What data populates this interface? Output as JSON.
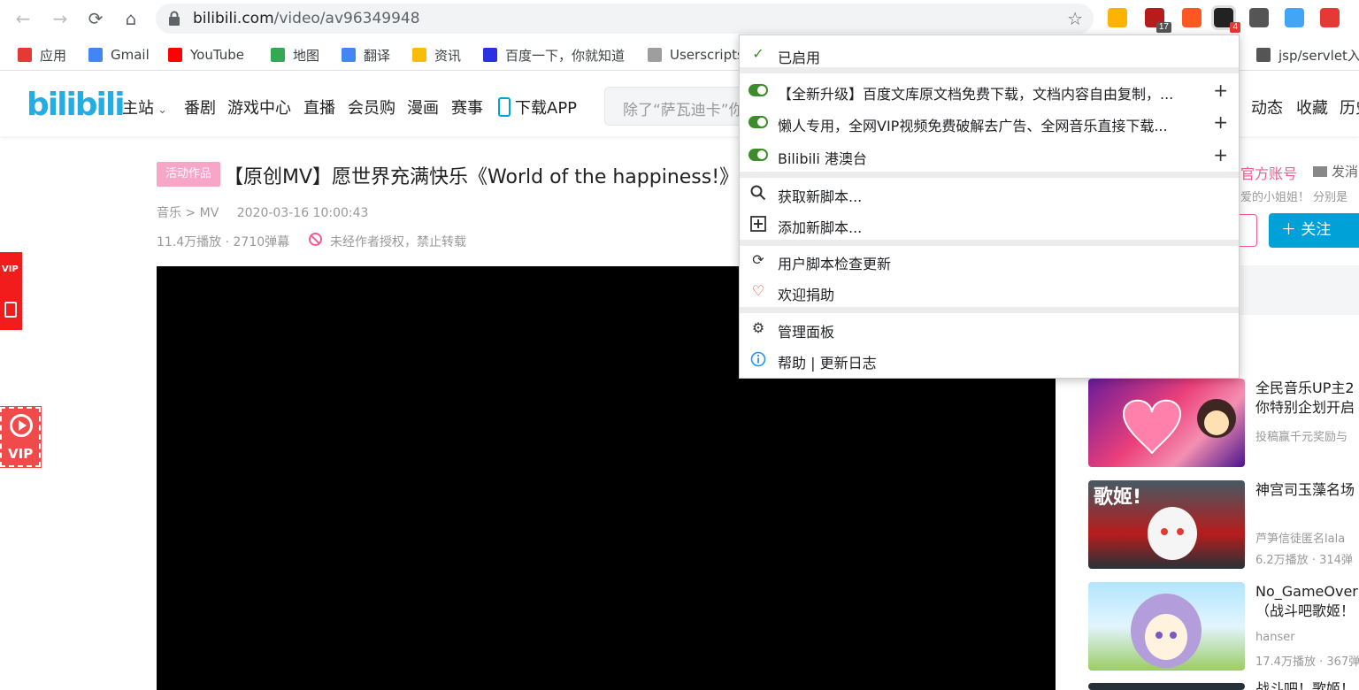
{
  "browser": {
    "url_host": "bilibili.com",
    "url_path": "/video/av96349948",
    "extensions": [
      {
        "name": "zap-icon",
        "color": "#ffb300",
        "badge": ""
      },
      {
        "name": "shield-icon",
        "color": "#b71c1c",
        "badge": "17"
      },
      {
        "name": "infinity-icon",
        "color": "#ff5722",
        "badge": ""
      },
      {
        "name": "tampermonkey-icon",
        "color": "#222222",
        "badge": "4"
      },
      {
        "name": "pocket-icon",
        "color": "#555555",
        "badge": ""
      },
      {
        "name": "search-circle-icon",
        "color": "#42a5f5",
        "badge": ""
      },
      {
        "name": "calendar-icon",
        "color": "#e53935",
        "badge": ""
      }
    ]
  },
  "bookmarks": [
    {
      "label": "应用",
      "color": "#e53935"
    },
    {
      "label": "Gmail",
      "color": "#4285f4"
    },
    {
      "label": "YouTube",
      "color": "#ff0000"
    },
    {
      "label": "地图",
      "color": "#34a853"
    },
    {
      "label": "翻译",
      "color": "#4285f4"
    },
    {
      "label": "资讯",
      "color": "#fbbc05"
    },
    {
      "label": "百度一下，你就知道",
      "color": "#2932e1"
    },
    {
      "label": "Userscripts",
      "color": "#9e9e9e"
    },
    {
      "label": "jsp/servlet入",
      "color": "#555555"
    }
  ],
  "bili": {
    "logo": "bilibili",
    "nav": [
      "主站",
      "番剧",
      "游戏中心",
      "直播",
      "会员购",
      "漫画",
      "赛事",
      "下载APP"
    ],
    "search_placeholder": "除了“萨瓦迪卡”你",
    "right_nav": [
      "动态",
      "收藏",
      "历史"
    ]
  },
  "video": {
    "tag": "活动作品",
    "title": "【原创MV】愿世界充满快乐《World of the happiness!》【",
    "category": "音乐 > MV",
    "date": "2020-03-16 10:00:43",
    "stats": "11.4万播放 · 2710弹幕",
    "no_repost": "未经作者授权，禁止转载"
  },
  "sidebar_vip": {
    "badge1": "VIP",
    "badge2": "VIP"
  },
  "uploader": {
    "official": "官方账号",
    "message": "发消",
    "desc": "爱的小姐姐！ 分别是",
    "follow": "＋  关注"
  },
  "recommendations": [
    {
      "title1": "全民音乐UP主2",
      "title2": "你特别企划开启",
      "up": "投稿赢千元奖励与",
      "stat": ""
    },
    {
      "title1": "神宫司玉藻名场",
      "title2": "",
      "up": "芦笋信徒匿名lala",
      "stat": "6.2万播放 · 314弹"
    },
    {
      "title1": "No_GameOver",
      "title2": "（战斗吧歌姬！",
      "up": "hanser",
      "stat": "17.4万播放 · 367弹"
    },
    {
      "title1": "战斗吧！歌姬！",
      "title2": "",
      "up": "",
      "stat": ""
    }
  ],
  "dropdown": {
    "enabled": "已启用",
    "scripts": [
      "【全新升级】百度文库原文档免费下载，文档内容自由复制，...",
      "懒人专用，全网VIP视频免费破解去广告、全网音乐直接下载...",
      "Bilibili 港澳台"
    ],
    "get_new": "获取新脚本...",
    "add_new": "添加新脚本...",
    "check_updates": "用户脚本检查更新",
    "donate": "欢迎捐助",
    "dashboard": "管理面板",
    "help": "帮助 | 更新日志"
  }
}
